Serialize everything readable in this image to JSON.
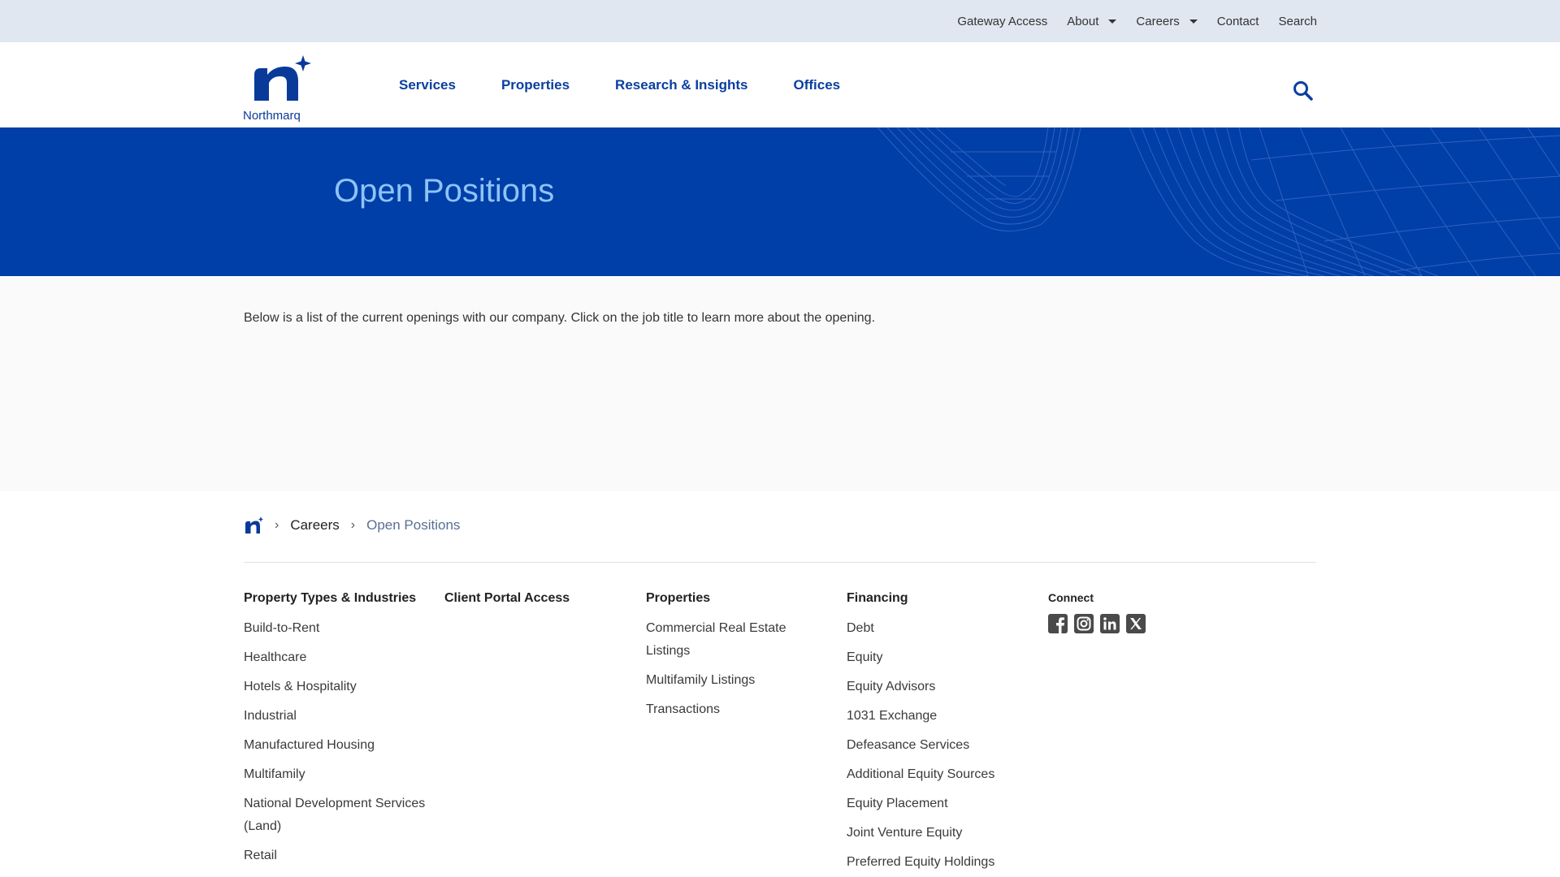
{
  "utility_nav": {
    "items": [
      {
        "label": "Gateway Access"
      },
      {
        "label": "About"
      },
      {
        "label": "Careers"
      },
      {
        "label": "Contact"
      },
      {
        "label": "Search"
      }
    ]
  },
  "brand": {
    "wordmark": "Northmarq",
    "accent_color": "#003ea8"
  },
  "main_nav": {
    "items": [
      {
        "label": "Services"
      },
      {
        "label": "Properties"
      },
      {
        "label": "Research & Insights"
      },
      {
        "label": "Offices"
      }
    ],
    "search_icon": "search-icon"
  },
  "hero": {
    "title": "Open Positions"
  },
  "content": {
    "intro": "Below is a list of the current openings with our company. Click on the job title to learn more about the opening."
  },
  "breadcrumb": {
    "home_icon": "northmarq-n-icon",
    "careers": "Careers",
    "current": "Open Positions"
  },
  "footer": {
    "col1": {
      "heading": "Property Types & Industries",
      "links": [
        "Build-to-Rent",
        "Healthcare",
        "Hotels & Hospitality",
        "Industrial",
        "Manufactured Housing",
        "Multifamily",
        "National Development Services (Land)",
        "Retail"
      ]
    },
    "col2": {
      "heading": "Client Portal Access"
    },
    "col3": {
      "heading": "Properties",
      "links": [
        "Commercial Real Estate Listings",
        "Multifamily Listings",
        "Transactions"
      ]
    },
    "col4": {
      "heading": "Financing",
      "links": [
        "Debt",
        "Equity",
        "Equity Advisors",
        "1031 Exchange",
        "Defeasance Services",
        "Additional Equity Sources",
        "Equity Placement",
        "Joint Venture Equity",
        "Preferred Equity Holdings"
      ]
    },
    "col5": {
      "heading": "Connect",
      "social_icons": [
        "facebook-icon",
        "instagram-icon",
        "linkedin-icon",
        "x-icon"
      ]
    }
  }
}
